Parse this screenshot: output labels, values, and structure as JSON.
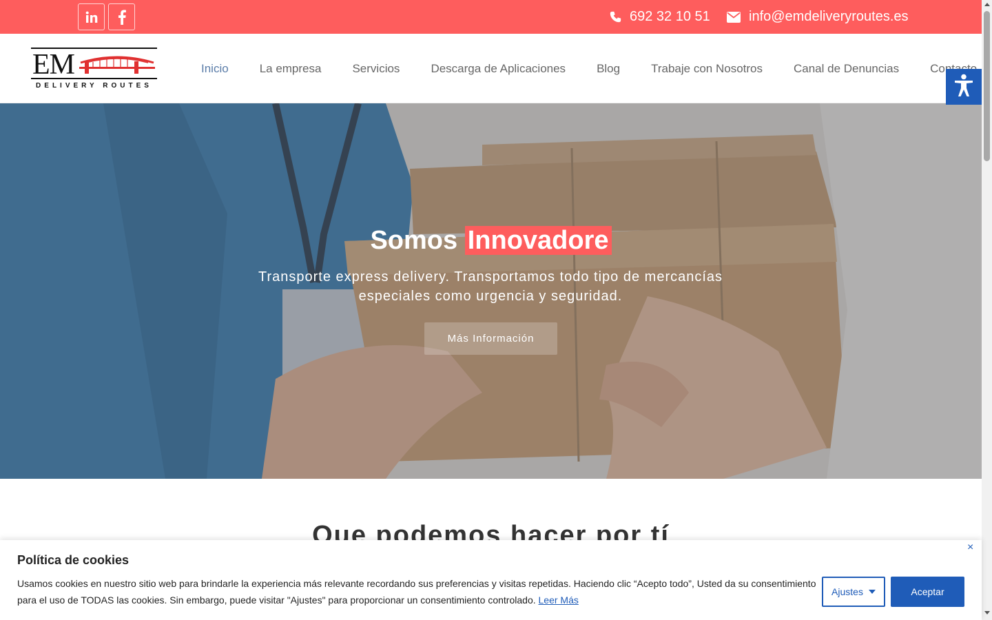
{
  "topbar": {
    "social": [
      {
        "icon": "linkedin-icon",
        "label": "in"
      },
      {
        "icon": "facebook-icon",
        "label": "f"
      }
    ],
    "phone": "692 32 10 51",
    "email": "info@emdeliveryroutes.es",
    "color": "#fe5d5d"
  },
  "logo": {
    "main": "EM",
    "sub": "DELIVERY ROUTES"
  },
  "nav": {
    "items": [
      "Inicio",
      "La empresa",
      "Servicios",
      "Descarga de Aplicaciones",
      "Blog",
      "Trabaje con Nosotros",
      "Canal de Denuncias",
      "Contacto"
    ],
    "active": "Inicio"
  },
  "hero": {
    "title_prefix": "Somos",
    "title_highlight": "Innovadore",
    "subtitle": "Transporte express delivery. Transportamos todo tipo de mercancías especiales como urgencia y seguridad.",
    "button": "Más Información"
  },
  "section": {
    "title": "Que podemos hacer por tí"
  },
  "cookie": {
    "title": "Política de cookies",
    "text": "Usamos cookies en nuestro sitio web para brindarle la experiencia más relevante recordando sus preferencias y visitas repetidas. Haciendo clic “Acepto todo”, Usted da su consentimiento para el uso de TODAS las cookies. Sin embargo, puede visitar \"Ajustes\" para proporcionar un consentimiento controlado.",
    "link": "Leer Más",
    "settings_button": "Ajustes",
    "accept_button": "Aceptar",
    "close": "×",
    "accent": "#1f5cb8"
  }
}
